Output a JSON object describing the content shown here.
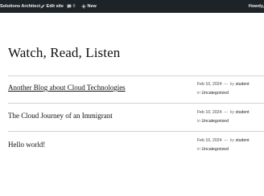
{
  "adminbar": {
    "site_name": "Solutions Architect",
    "edit_site": "Edit site",
    "comments_count": "0",
    "new_label": "New",
    "howdy": "Howdy,"
  },
  "site": {
    "title": "Watch, Read, Listen"
  },
  "posts": [
    {
      "title": "Another Blog about Cloud Technologies",
      "date": "Feb 10, 2024",
      "separator": "—",
      "by": "by",
      "author": "student",
      "in": "in",
      "category": "Uncategorized"
    },
    {
      "title": "The Cloud Journey of an Immigrant",
      "date": "Feb 10, 2024",
      "separator": "—",
      "by": "by",
      "author": "student",
      "in": "in",
      "category": "Uncategorized"
    },
    {
      "title": "Hello world!",
      "date": "Feb 10, 2024",
      "separator": "—",
      "by": "by",
      "author": "student",
      "in": "in",
      "category": "Uncategorized"
    }
  ]
}
